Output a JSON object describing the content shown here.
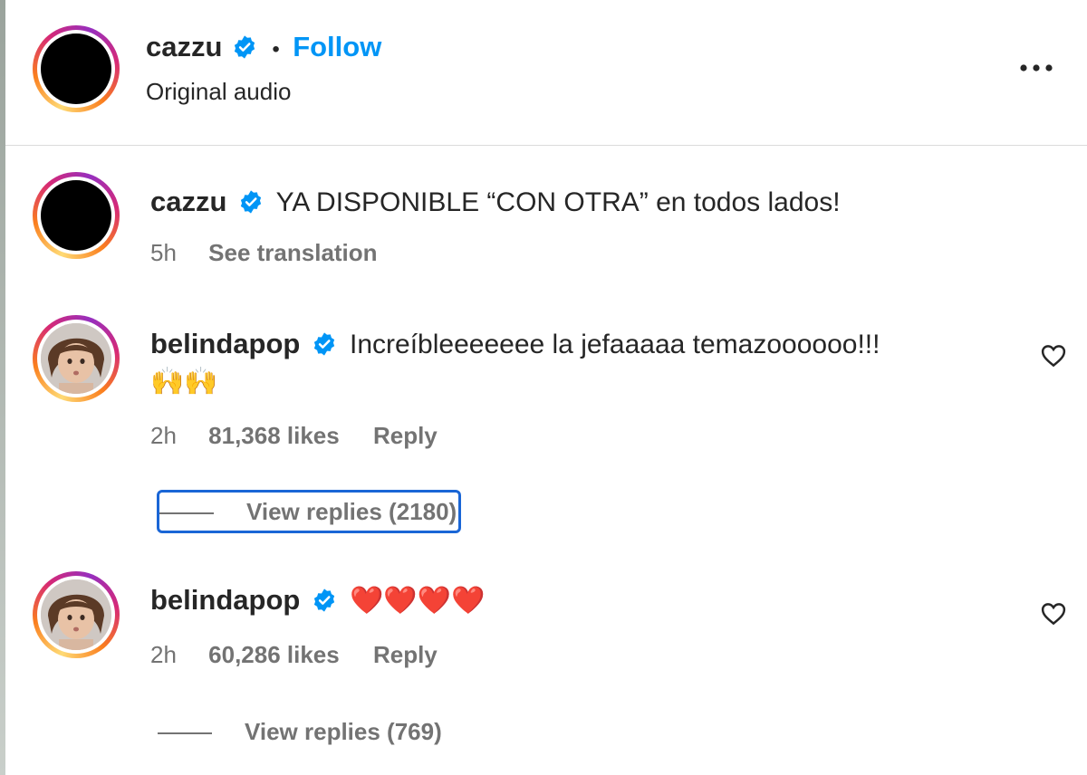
{
  "post_header": {
    "username": "cazzu",
    "separator": "•",
    "follow_label": "Follow",
    "subtitle": "Original audio"
  },
  "caption": {
    "username": "cazzu",
    "text": "YA DISPONIBLE “CON OTRA” en todos lados!",
    "age": "5h",
    "see_translation": "See translation"
  },
  "comments": [
    {
      "username": "belindapop",
      "text": "Increíbleeeeeee la jefaaaaa temazoooooo!!!",
      "emoji_line": "🙌🙌",
      "age": "2h",
      "likes": "81,368 likes",
      "reply_label": "Reply",
      "view_replies": "View replies (2180)"
    },
    {
      "username": "belindapop",
      "text": "❤️❤️❤️❤️",
      "age": "2h",
      "likes": "60,286 likes",
      "reply_label": "Reply",
      "view_replies": "View replies (769)"
    }
  ],
  "icons": {
    "verified": "verified-badge-icon",
    "more": "more-options-icon",
    "like": "heart-outline-icon"
  },
  "colors": {
    "link_blue": "#0095f6",
    "verified_blue": "#0095f6",
    "muted_text": "#737373",
    "focus_outline": "#1a66d6"
  }
}
